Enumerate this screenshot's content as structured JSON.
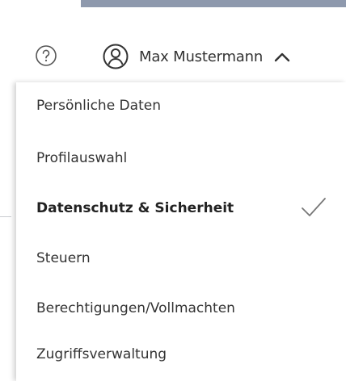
{
  "header": {
    "user_name": "Max Mustermann"
  },
  "icons": {
    "help": "help-circle-icon",
    "user": "user-circle-icon",
    "chevron": "chevron-up-icon",
    "check": "checkmark-icon"
  },
  "menu": {
    "items": [
      {
        "label": "Persönliche Daten"
      },
      {
        "label": "Profilauswahl"
      },
      {
        "label": "Datenschutz & Sicherheit",
        "active": true
      },
      {
        "label": "Steuern"
      },
      {
        "label": "Berechtigungen/Vollmachten"
      },
      {
        "label": "Zugriffsverwaltung"
      }
    ]
  },
  "colors": {
    "top_bar": "#8e99ad",
    "text": "#333333"
  }
}
